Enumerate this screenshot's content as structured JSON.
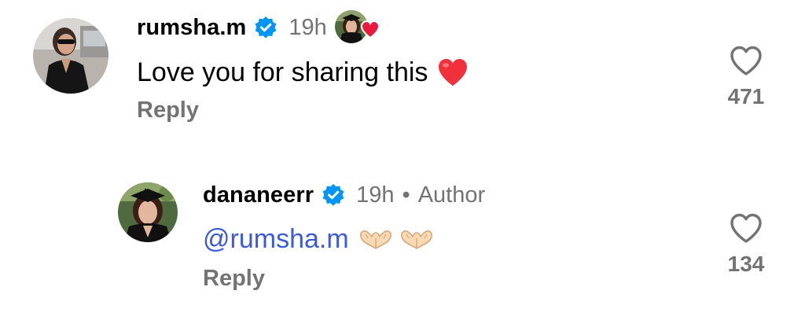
{
  "comments": [
    {
      "username": "rumsha.m",
      "verified": true,
      "time": "19h",
      "liked_by_author": true,
      "text": "Love you for sharing this",
      "emoji": "heart-emoji",
      "reply_label": "Reply",
      "like_count": "471"
    },
    {
      "username": "dananeerr",
      "verified": true,
      "time": "19h",
      "separator": "•",
      "role": "Author",
      "mention": "@rumsha.m",
      "emoji": "heart-hands-emoji",
      "reply_label": "Reply",
      "like_count": "134"
    }
  ],
  "colors": {
    "verified": "#0095f6",
    "heart_red": "#e81b3f",
    "mention": "#3d5bd9",
    "muted_text": "#737373"
  }
}
